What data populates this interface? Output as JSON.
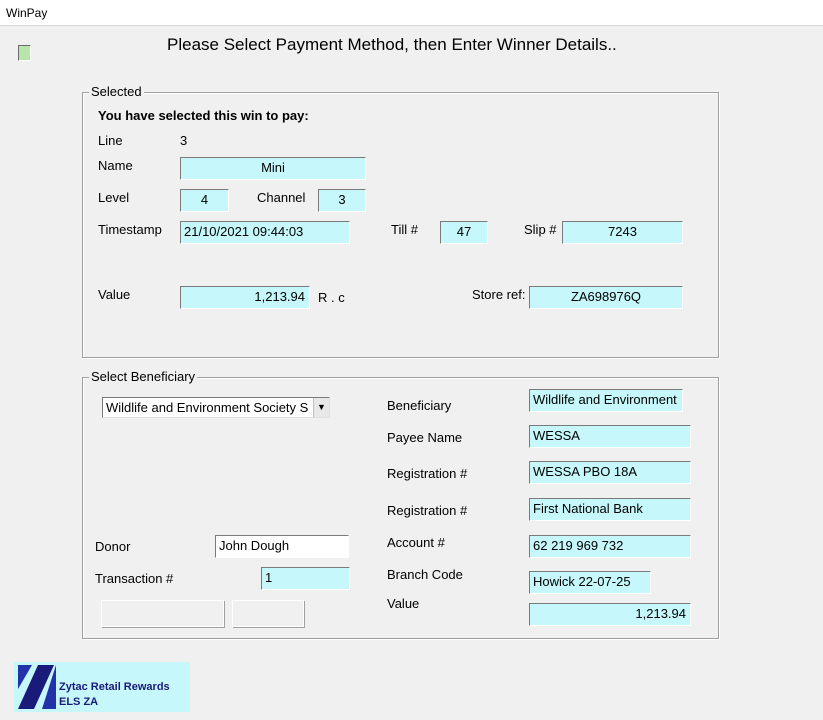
{
  "window": {
    "title": "WinPay"
  },
  "heading": "Please Select Payment Method, then Enter Winner Details..",
  "selected": {
    "legend": "Selected",
    "intro": "You have selected this win to pay:",
    "line_label": "Line",
    "line_value": "3",
    "name_label": "Name",
    "name_value": "Mini",
    "level_label": "Level",
    "level_value": "4",
    "channel_label": "Channel",
    "channel_value": "3",
    "timestamp_label": "Timestamp",
    "timestamp_value": "21/10/2021 09:44:03",
    "till_label": "Till #",
    "till_value": "47",
    "slip_label": "Slip #",
    "slip_value": "7243",
    "value_label": "Value",
    "value_value": "1,213.94",
    "currency": "R . c",
    "storeref_label": "Store ref:",
    "storeref_value": "ZA698976Q"
  },
  "beneficiary": {
    "legend": "Select Beneficiary",
    "dropdown_selected": "Wildlife and Environment Society S",
    "beneficiary_label": "Beneficiary",
    "beneficiary_value": "Wildlife and Environment",
    "payee_label": "Payee Name",
    "payee_value": "WESSA",
    "registration1_label": "Registration #",
    "registration1_value": "WESSA PBO 18A",
    "registration2_label": "Registration #",
    "registration2_value": "First National Bank",
    "account_label": "Account #",
    "account_value": "62 219 969 732",
    "branch_label": "Branch Code",
    "branch_value": "Howick 22-07-25",
    "value_label": "Value",
    "value_value": "1,213.94",
    "donor_label": "Donor",
    "donor_value": "John Dough",
    "transaction_label": "Transaction #",
    "transaction_value": "1"
  },
  "logo": {
    "line1": "Zytac Retail Rewards",
    "line2": "ELS  ZA"
  },
  "colors": {
    "field_bg": "#c6f7fb",
    "window_bg": "#f0f0f0",
    "logo_text": "#1a1a7a",
    "status_led": "#b8e6a8"
  }
}
